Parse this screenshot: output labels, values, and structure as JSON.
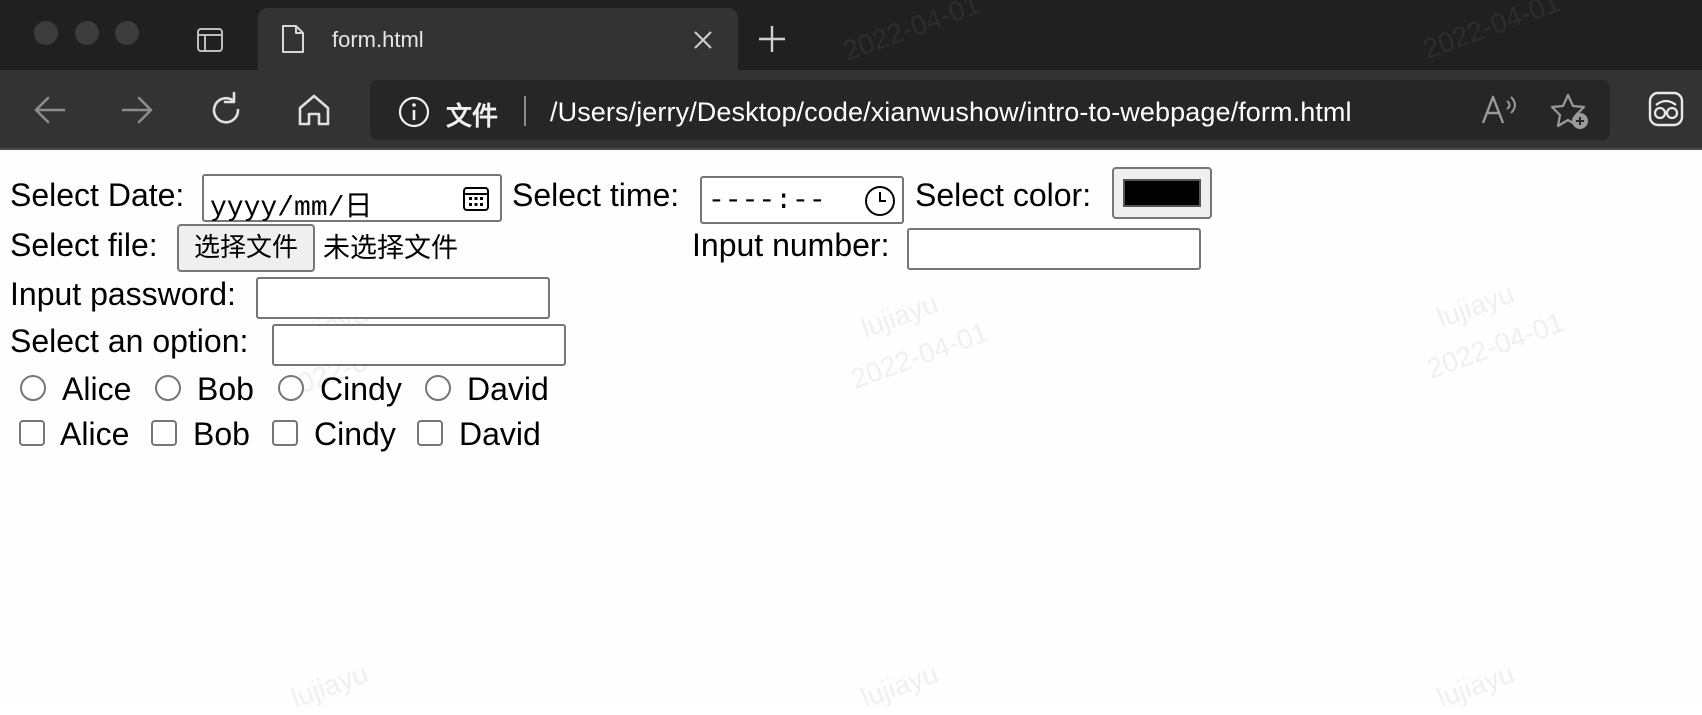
{
  "browser": {
    "tab_title": "form.html",
    "scheme_label": "文件",
    "url": "/Users/jerry/Desktop/code/xianwushow/intro-to-webpage/form.html",
    "icons": {
      "back": "arrow-left-icon",
      "forward": "arrow-right-icon",
      "reload": "reload-icon",
      "home": "home-icon",
      "info": "info-icon",
      "read_aloud": "read-aloud-icon",
      "favorites": "add-favorite-icon",
      "profile": "profile-icon"
    }
  },
  "form": {
    "date_label": "Select Date:",
    "date_placeholder": "yyyy/mm/日",
    "time_label": "Select time:",
    "time_placeholder": "----:--",
    "color_label": "Select color:",
    "color_value": "#000000",
    "file_label": "Select file:",
    "file_button": "选择文件",
    "file_status": "未选择文件",
    "number_label": "Input number:",
    "number_value": "",
    "password_label": "Input password:",
    "password_value": "",
    "option_label": "Select an option:",
    "option_value": "",
    "radios": [
      "Alice",
      "Bob",
      "Cindy",
      "David"
    ],
    "checkboxes": [
      "Alice",
      "Bob",
      "Cindy",
      "David"
    ]
  },
  "watermark": {
    "name": "lujiayu",
    "date": "2022-04-01"
  }
}
